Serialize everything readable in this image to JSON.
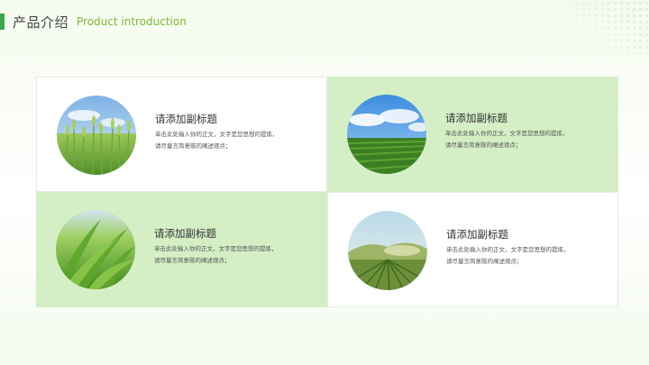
{
  "header": {
    "title_zh": "产品介绍",
    "title_en": "Product introduction"
  },
  "cards": [
    {
      "title": "请添加副标题",
      "body_line1": "单击此处输入你的正文，文字是您思想的提炼，",
      "body_line2": "请尽量言简意赅的阐述观点；"
    },
    {
      "title": "请添加副标题",
      "body_line1": "单击此处输入你的正文，文字是您思想的提炼，",
      "body_line2": "请尽量言简意赅的阐述观点；"
    },
    {
      "title": "请添加副标题",
      "body_line1": "单击此处输入你的正文，文字是您思想的提炼，",
      "body_line2": "请尽量言简意赅的阐述观点；"
    },
    {
      "title": "请添加副标题",
      "body_line1": "单击此处输入你的正文，文字是您思想的提炼，",
      "body_line2": "请尽量言简意赅的阐述观点；"
    }
  ],
  "colors": {
    "accent": "#3aa84a",
    "english_title": "#7dbb34",
    "card_green": "#d4efc5"
  }
}
